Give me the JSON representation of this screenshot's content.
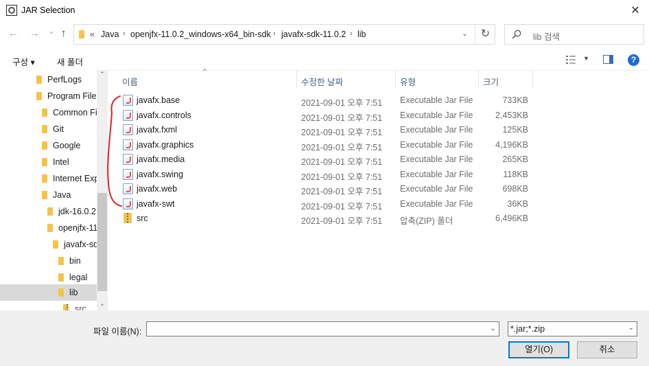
{
  "window": {
    "title": "JAR Selection",
    "close_glyph": "✕"
  },
  "nav": {
    "back_glyph": "←",
    "forward_glyph": "→",
    "recent_glyph": "⌄",
    "up_glyph": "↑",
    "overflow": "«",
    "breadcrumbs": [
      "Java",
      "openjfx-11.0.2_windows-x64_bin-sdk",
      "javafx-sdk-11.0.2",
      "lib"
    ],
    "refresh_glyph": "↻",
    "search_placeholder": "lib 검색"
  },
  "toolbar": {
    "organize": "구성 ▾",
    "new_folder": "새 폴더",
    "help": "?"
  },
  "tree": [
    {
      "label": "PerfLogs"
    },
    {
      "label": "Program Files"
    },
    {
      "label": "Common Fi"
    },
    {
      "label": "Git"
    },
    {
      "label": "Google"
    },
    {
      "label": "Intel"
    },
    {
      "label": "Internet Exp"
    },
    {
      "label": "Java"
    },
    {
      "label": "jdk-16.0.2"
    },
    {
      "label": "openjfx-11"
    },
    {
      "label": "javafx-sd"
    },
    {
      "label": "bin"
    },
    {
      "label": "legal"
    },
    {
      "label": "lib"
    },
    {
      "label": "src"
    }
  ],
  "columns": {
    "name": "이름",
    "date": "수정한 날짜",
    "type": "유형",
    "size": "크기"
  },
  "files": [
    {
      "name": "javafx.base",
      "date": "2021-09-01 오후 7:51",
      "type": "Executable Jar File",
      "size": "733KB",
      "icon": "jar-icon"
    },
    {
      "name": "javafx.controls",
      "date": "2021-09-01 오후 7:51",
      "type": "Executable Jar File",
      "size": "2,453KB",
      "icon": "jar-icon"
    },
    {
      "name": "javafx.fxml",
      "date": "2021-09-01 오후 7:51",
      "type": "Executable Jar File",
      "size": "125KB",
      "icon": "jar-icon"
    },
    {
      "name": "javafx.graphics",
      "date": "2021-09-01 오후 7:51",
      "type": "Executable Jar File",
      "size": "4,196KB",
      "icon": "jar-icon"
    },
    {
      "name": "javafx.media",
      "date": "2021-09-01 오후 7:51",
      "type": "Executable Jar File",
      "size": "265KB",
      "icon": "jar-icon"
    },
    {
      "name": "javafx.swing",
      "date": "2021-09-01 오후 7:51",
      "type": "Executable Jar File",
      "size": "118KB",
      "icon": "jar-icon"
    },
    {
      "name": "javafx.web",
      "date": "2021-09-01 오후 7:51",
      "type": "Executable Jar File",
      "size": "698KB",
      "icon": "jar-icon"
    },
    {
      "name": "javafx-swt",
      "date": "2021-09-01 오후 7:51",
      "type": "Executable Jar File",
      "size": "36KB",
      "icon": "jar-icon"
    },
    {
      "name": "src",
      "date": "2021-09-01 오후 7:51",
      "type": "압축(ZIP) 폴더",
      "size": "6,496KB",
      "icon": "zip-icon"
    }
  ],
  "bottom": {
    "filename_label": "파일 이름(N):",
    "filename_value": "",
    "filter_value": "*.jar;*.zip",
    "open_label": "열기(O)",
    "cancel_label": "취소"
  },
  "colors": {
    "accent": "#0078d7",
    "folder": "#f4c44a",
    "annotation": "#e02020",
    "selected": "#d9d9d9"
  }
}
